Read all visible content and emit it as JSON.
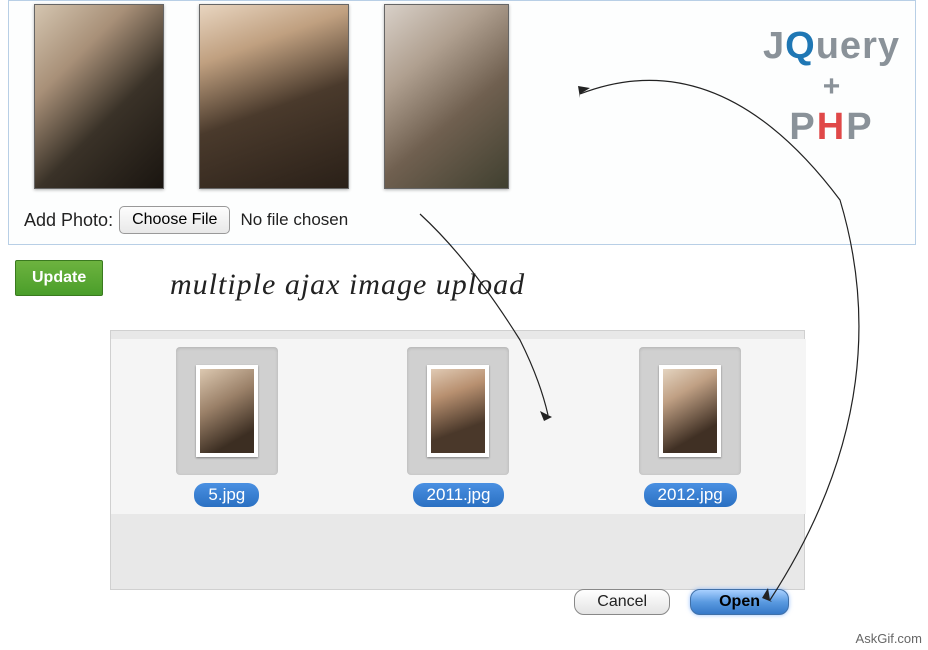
{
  "upload_box": {
    "add_label": "Add Photo:",
    "choose_button": "Choose File",
    "no_file_text": "No file chosen"
  },
  "logo": {
    "j": "J",
    "q": "Q",
    "uery": "uery",
    "plus": "+",
    "p": "P",
    "h": "H",
    "p2": "P"
  },
  "update_button": "Update",
  "script_text": "multiple ajax image upload",
  "file_dialog": {
    "items": [
      {
        "name": "5.jpg"
      },
      {
        "name": "2011.jpg"
      },
      {
        "name": "2012.jpg"
      }
    ],
    "buttons": {
      "cancel": "Cancel",
      "open": "Open"
    }
  },
  "watermark": "AskGif.com"
}
